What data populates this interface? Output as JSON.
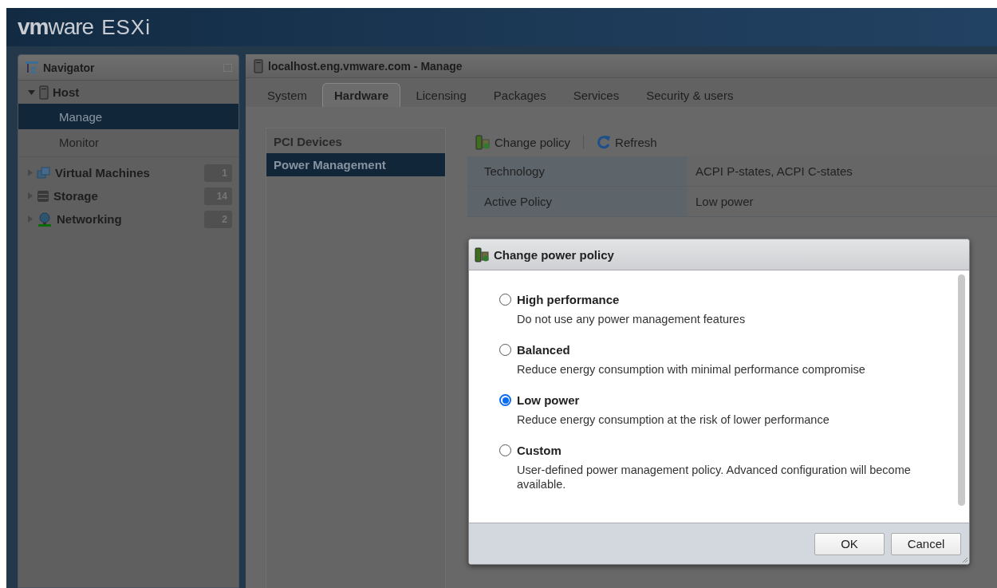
{
  "header": {
    "logo": "**vm**ware",
    "product": "ESXi"
  },
  "navigator": {
    "title": "Navigator",
    "items": [
      {
        "label": "Host",
        "kind": "host",
        "expanded": true,
        "selected": false,
        "children": [
          {
            "label": "Manage",
            "selected": true
          },
          {
            "label": "Monitor",
            "selected": false
          }
        ]
      },
      {
        "label": "Virtual Machines",
        "kind": "vm",
        "expanded": false,
        "selected": false,
        "count": "1"
      },
      {
        "label": "Storage",
        "kind": "storage",
        "expanded": false,
        "selected": false,
        "count": "14"
      },
      {
        "label": "Networking",
        "kind": "network",
        "expanded": false,
        "selected": false,
        "count": "2"
      }
    ]
  },
  "main": {
    "title": "localhost.eng.vmware.com - Manage",
    "tabs": [
      {
        "label": "System",
        "selected": false
      },
      {
        "label": "Hardware",
        "selected": true
      },
      {
        "label": "Licensing",
        "selected": false
      },
      {
        "label": "Packages",
        "selected": false
      },
      {
        "label": "Services",
        "selected": false
      },
      {
        "label": "Security & users",
        "selected": false
      }
    ],
    "subnav": [
      {
        "label": "PCI Devices",
        "selected": false
      },
      {
        "label": "Power Management",
        "selected": true
      }
    ],
    "toolbar": [
      {
        "label": "Change policy",
        "kind": "policy"
      },
      {
        "label": "Refresh",
        "kind": "refresh"
      }
    ],
    "details": [
      {
        "label": "Technology",
        "value": "ACPI P-states, ACPI C-states"
      },
      {
        "label": "Active Policy",
        "value": "Low power"
      }
    ]
  },
  "dialog": {
    "title": "Change power policy",
    "options": [
      {
        "label": "High performance",
        "description": "Do not use any power management features",
        "selected": false
      },
      {
        "label": "Balanced",
        "description": "Reduce energy consumption with minimal performance compromise",
        "selected": false
      },
      {
        "label": "Low power",
        "description": "Reduce energy consumption at the risk of lower performance",
        "selected": true
      },
      {
        "label": "Custom",
        "description": "User-defined power management policy. Advanced configuration will become available.",
        "selected": false
      }
    ],
    "buttons": [
      {
        "label": "OK"
      },
      {
        "label": "Cancel"
      }
    ]
  }
}
